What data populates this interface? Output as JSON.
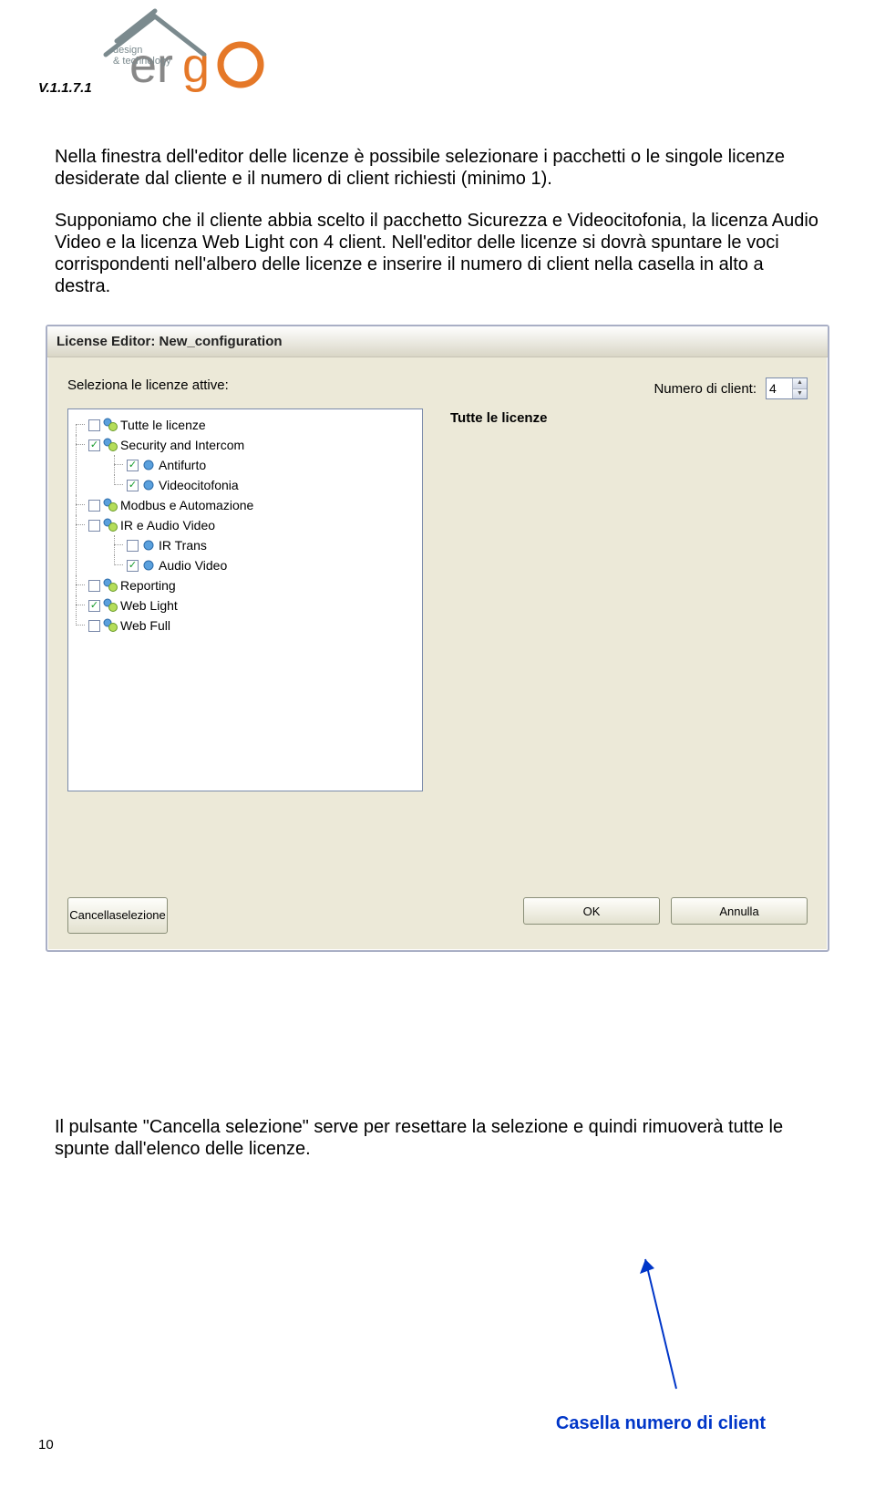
{
  "header": {
    "version": "V.1.1.7.1",
    "logo": {
      "text_top": "design",
      "text_bottom": "& technology",
      "brand": "ergo"
    }
  },
  "body": {
    "p1": "Nella finestra dell'editor delle licenze è possibile selezionare i pacchetti o le singole licenze desiderate dal cliente e il numero di client richiesti (minimo 1).",
    "p2": "Supponiamo che il cliente abbia scelto il pacchetto Sicurezza e Videocitofonia, la licenza Audio Video e la licenza Web Light con 4 client. Nell'editor delle licenze si dovrà spuntare le voci corrispondenti nell'albero delle licenze e inserire il numero di client nella casella in alto a destra."
  },
  "dialog": {
    "title": "License Editor: New_configuration",
    "left_label": "Seleziona le licenze attive:",
    "right_label": "Numero di client:",
    "client_value": "4",
    "right_panel_title": "Tutte le licenze",
    "tree": [
      {
        "label": "Tutte le licenze",
        "checked": false,
        "icon": "package"
      },
      {
        "label": "Security and Intercom",
        "checked": true,
        "icon": "package",
        "children": [
          {
            "label": "Antifurto",
            "checked": true,
            "icon": "item"
          },
          {
            "label": "Videocitofonia",
            "checked": true,
            "icon": "item"
          }
        ]
      },
      {
        "label": "Modbus e Automazione",
        "checked": false,
        "icon": "package"
      },
      {
        "label": "IR e Audio Video",
        "checked": false,
        "icon": "package",
        "children": [
          {
            "label": "IR Trans",
            "checked": false,
            "icon": "item"
          },
          {
            "label": "Audio Video",
            "checked": true,
            "icon": "item"
          }
        ]
      },
      {
        "label": "Reporting",
        "checked": false,
        "icon": "package"
      },
      {
        "label": "Web Light",
        "checked": true,
        "icon": "package"
      },
      {
        "label": "Web Full",
        "checked": false,
        "icon": "package"
      }
    ],
    "buttons": {
      "clear": "Cancella\nselezione",
      "ok": "OK",
      "cancel": "Annulla"
    }
  },
  "footer": {
    "text": "Il pulsante \"Cancella selezione\" serve per resettare la selezione e quindi rimuoverà tutte le spunte dall'elenco delle licenze.",
    "blue_label": "Casella numero di client",
    "page_number": "10"
  }
}
